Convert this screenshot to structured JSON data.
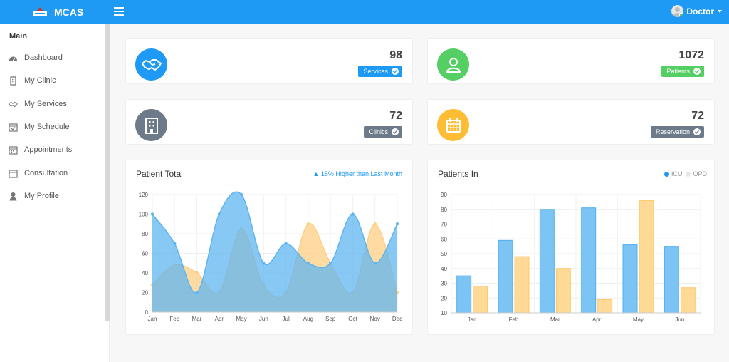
{
  "app": {
    "name": "MCAS",
    "user": "Doctor",
    "accent": "#1e9af5"
  },
  "sidebar": {
    "section": "Main",
    "items": [
      {
        "label": "Dashboard",
        "icon": "dashboard-icon"
      },
      {
        "label": "My Clinic",
        "icon": "clinic-icon"
      },
      {
        "label": "My Services",
        "icon": "handshake-icon"
      },
      {
        "label": "My Schedule",
        "icon": "calendar-check-icon"
      },
      {
        "label": "Appointments",
        "icon": "calendar-icon"
      },
      {
        "label": "Consultation",
        "icon": "calendar-icon"
      },
      {
        "label": "My Profile",
        "icon": "user-icon"
      }
    ]
  },
  "stats": [
    {
      "value": "98",
      "label": "Services",
      "color": "#1e9af5",
      "icon": "handshake-icon"
    },
    {
      "value": "1072",
      "label": "Patients",
      "color": "#55ce63",
      "icon": "user-icon"
    },
    {
      "value": "72",
      "label": "Clinics",
      "color": "#6c7a89",
      "icon": "hospital-icon"
    },
    {
      "value": "72",
      "label": "Reservation",
      "color": "#6c7a89",
      "icon_color": "#ffbc35",
      "icon": "calendar-icon"
    }
  ],
  "patient_total": {
    "title": "Patient Total",
    "note": "15% Higher than Last Month"
  },
  "patients_in": {
    "title": "Patients In",
    "legend": [
      "ICU",
      "OPD"
    ]
  },
  "chart_data": [
    {
      "type": "area",
      "title": "Patient Total",
      "categories": [
        "Jan",
        "Feb",
        "Mar",
        "Apr",
        "May",
        "Jun",
        "Jul",
        "Aug",
        "Sep",
        "Oct",
        "Nov",
        "Dec"
      ],
      "series": [
        {
          "color": "#5fb5f0",
          "values": [
            100,
            70,
            20,
            100,
            120,
            50,
            70,
            50,
            50,
            100,
            50,
            90
          ]
        },
        {
          "color": "#ffcf86",
          "values": [
            28,
            48,
            40,
            20,
            85,
            27,
            20,
            90,
            50,
            20,
            90,
            20
          ]
        }
      ],
      "ylim": [
        0,
        120
      ],
      "yticks": [
        0,
        20,
        40,
        60,
        80,
        100,
        120
      ],
      "grid": true
    },
    {
      "type": "bar",
      "title": "Patients In",
      "categories": [
        "Jan",
        "Feb",
        "Mar",
        "Apr",
        "May",
        "Jun"
      ],
      "series": [
        {
          "name": "ICU",
          "color": "#7cc4f4",
          "values": [
            35,
            59,
            80,
            81,
            56,
            55
          ]
        },
        {
          "name": "OPD",
          "color": "#ffd996",
          "values": [
            28,
            48,
            40,
            19,
            86,
            27
          ]
        }
      ],
      "ylim": [
        10,
        90
      ],
      "yticks": [
        10,
        20,
        30,
        40,
        50,
        60,
        70,
        80,
        90
      ],
      "grid": true,
      "legend": "top-right"
    }
  ]
}
